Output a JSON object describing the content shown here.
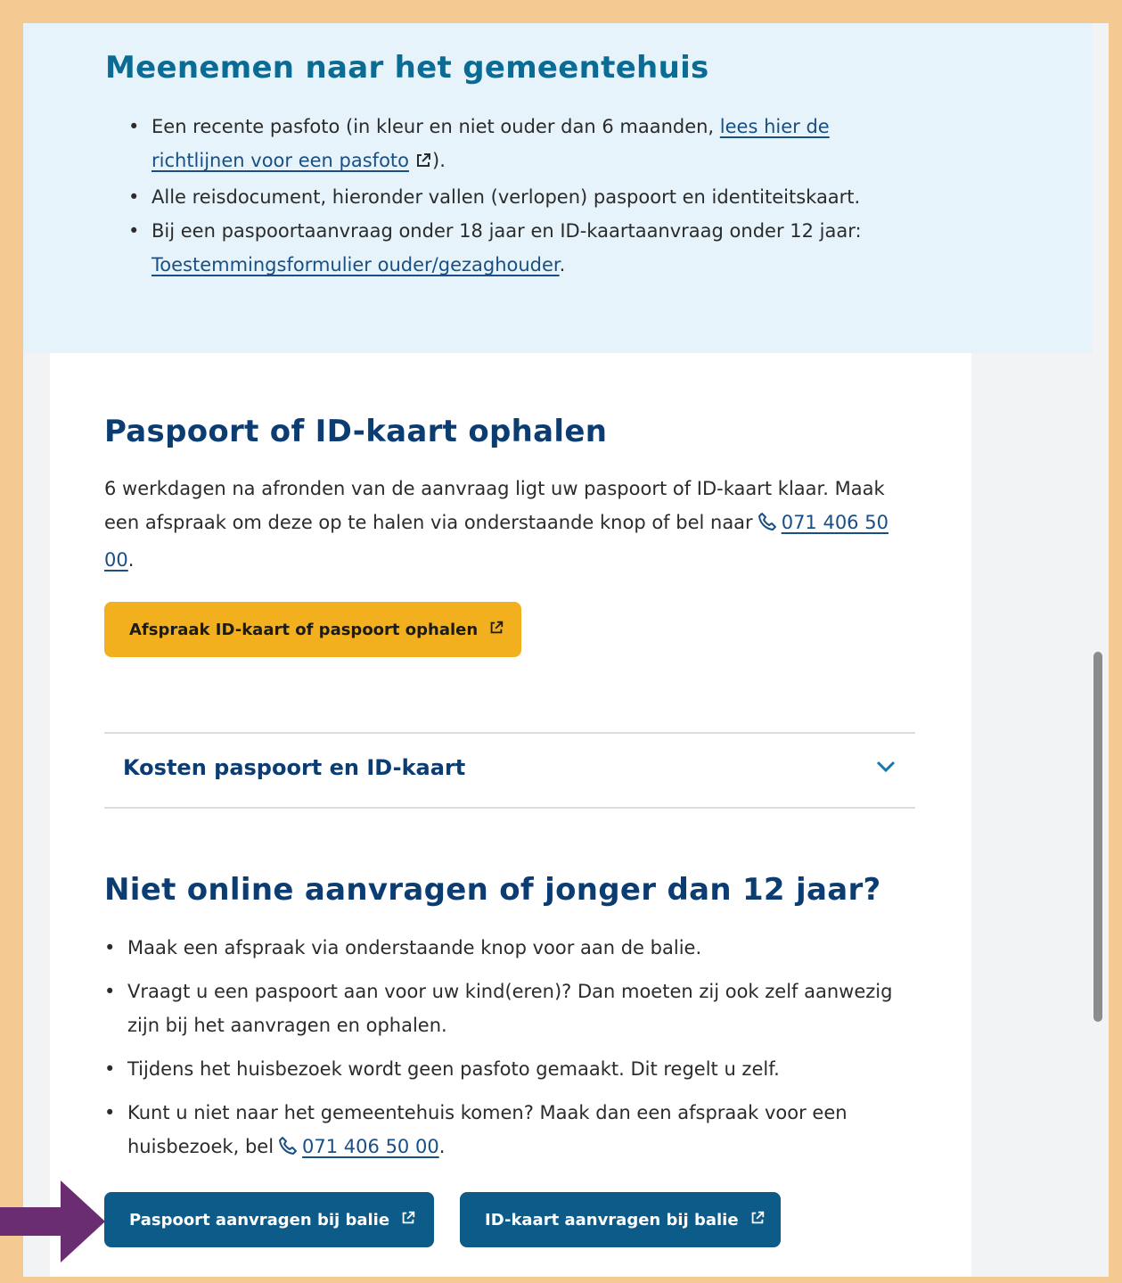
{
  "info_section": {
    "heading": "Meenemen naar het gemeentehuis",
    "bullet1_text": "Een recente pasfoto (in kleur en niet ouder dan 6 maanden,",
    "bullet1_link": "lees hier de richtlijnen voor een pasfoto",
    "bullet1_suffix": ").",
    "bullet2_text": "Alle reisdocument, hieronder vallen (verlopen) paspoort en identiteitskaart.",
    "bullet3_text": "Bij een paspoortaanvraag onder 18 jaar en ID-kaartaanvraag onder 12 jaar:",
    "bullet3_link": "Toestemmingsformulier ouder/gezaghouder",
    "bullet3_suffix": "."
  },
  "pickup_section": {
    "heading": "Paspoort of ID-kaart ophalen",
    "paragraph": "6 werkdagen na afronden van de aanvraag ligt uw paspoort of ID-kaart klaar. Maak een afspraak om deze op te halen via onderstaande knop of bel naar",
    "phone": "071 406 50 00",
    "paragraph_suffix": ".",
    "button_label": "Afspraak ID-kaart of paspoort ophalen"
  },
  "accordion": {
    "title": "Kosten paspoort en ID-kaart"
  },
  "offline_section": {
    "heading": "Niet online aanvragen of jonger dan 12 jaar?",
    "bullet1": "Maak een afspraak via onderstaande knop voor aan de balie.",
    "bullet2": "Vraagt u een paspoort aan voor uw kind(eren)? Dan moeten zij ook zelf aanwezig zijn bij het aanvragen en ophalen.",
    "bullet3": "Tijdens het huisbezoek wordt geen pasfoto gemaakt. Dit regelt u zelf.",
    "bullet4_text": "Kunt u niet naar het gemeentehuis komen? Maak dan een afspraak voor een huisbezoek, bel",
    "bullet4_phone": "071 406 50 00",
    "bullet4_suffix": ".",
    "button_passport": "Paspoort aanvragen bij balie",
    "button_id": "ID-kaart aanvragen bij balie"
  },
  "colors": {
    "frame": "#f4c992",
    "info_band": "#e6f3fa",
    "heading": "#0b3d73",
    "primary_button": "#0c5b89",
    "secondary_button": "#f2b01e",
    "arrow": "#6b2d72"
  }
}
